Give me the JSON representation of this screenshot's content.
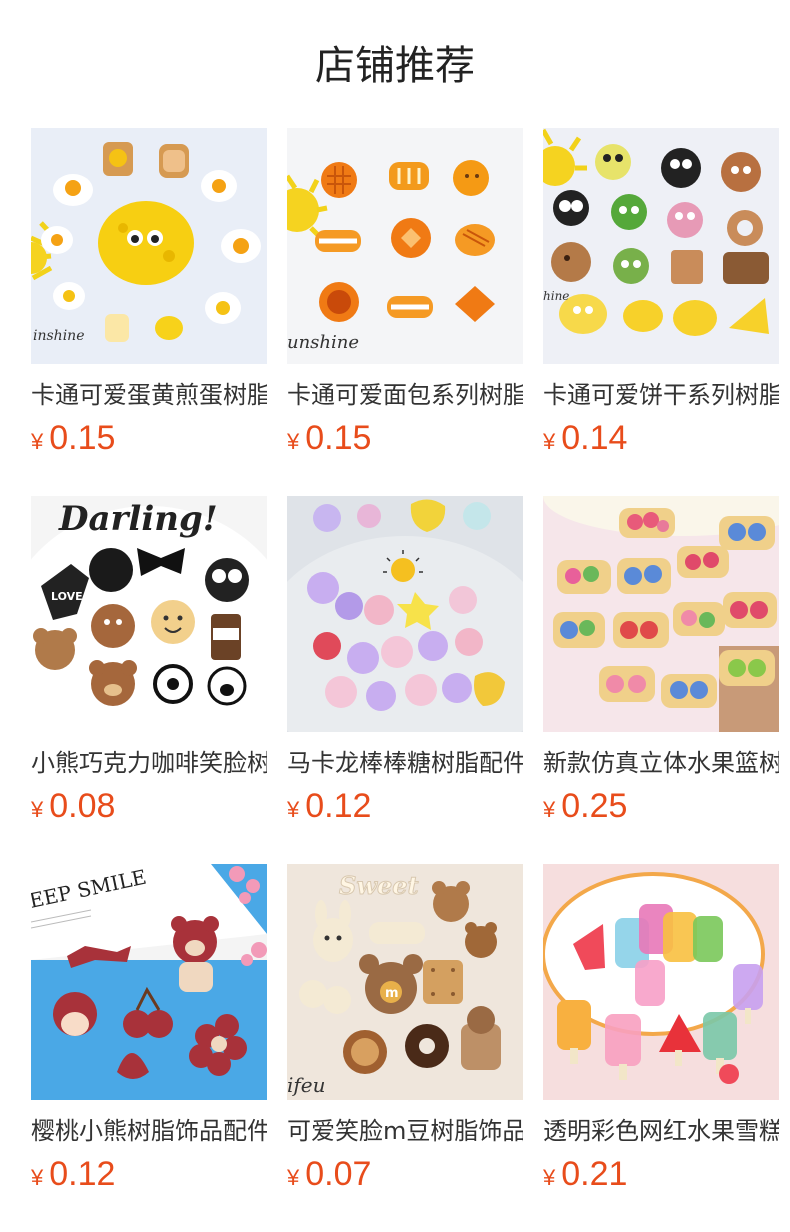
{
  "page": {
    "title": "店铺推荐"
  },
  "products": [
    {
      "title": "卡通可爱蛋黄煎蛋树脂配件",
      "currency": "¥",
      "price": "0.15",
      "image": "egg-yolk-charms",
      "theme": "#e8eef8"
    },
    {
      "title": "卡通可爱面包系列树脂配件",
      "currency": "¥",
      "price": "0.15",
      "image": "bread-charms",
      "theme": "#f3f4f6"
    },
    {
      "title": "卡通可爱饼干系列树脂配件",
      "currency": "¥",
      "price": "0.14",
      "image": "cookie-charms",
      "theme": "#eef0f6"
    },
    {
      "title": "小熊巧克力咖啡笑脸树脂配件",
      "currency": "¥",
      "price": "0.08",
      "image": "bear-chocolate-charms",
      "theme": "#f4f4f4"
    },
    {
      "title": "马卡龙棒棒糖树脂配件",
      "currency": "¥",
      "price": "0.12",
      "image": "lollipop-charms",
      "theme": "#dfe3e8"
    },
    {
      "title": "新款仿真立体水果篮树脂配件",
      "currency": "¥",
      "price": "0.25",
      "image": "fruit-basket-charms",
      "theme": "#f6e6ea"
    },
    {
      "title": "樱桃小熊树脂饰品配件",
      "currency": "¥",
      "price": "0.12",
      "image": "cherry-bear-charms",
      "theme": "#4aa8e6"
    },
    {
      "title": "可爱笑脸m豆树脂饰品配件",
      "currency": "¥",
      "price": "0.07",
      "image": "smiley-m-bean-charms",
      "theme": "#efe6dc"
    },
    {
      "title": "透明彩色网红水果雪糕树脂配件",
      "currency": "¥",
      "price": "0.21",
      "image": "fruit-popsicle-charms",
      "theme": "#f6dede"
    }
  ]
}
